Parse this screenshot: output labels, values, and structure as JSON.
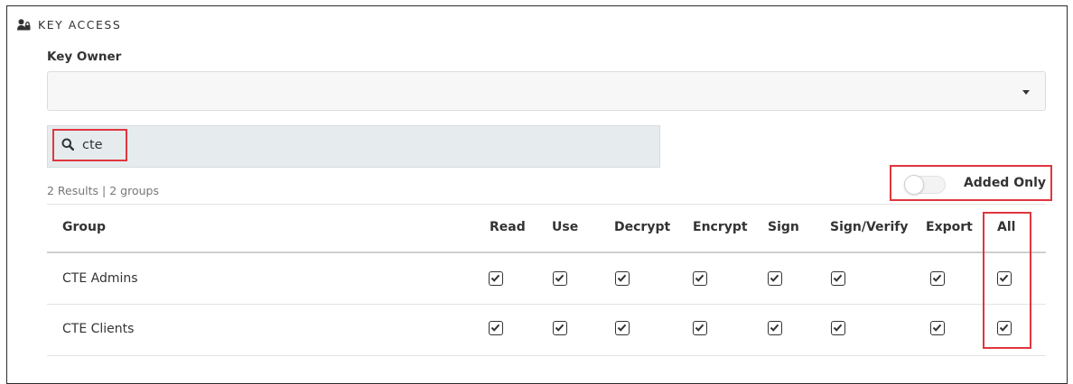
{
  "section": {
    "title": "KEY ACCESS",
    "icon": "user-lock-icon"
  },
  "key_owner": {
    "label": "Key Owner",
    "value": "",
    "dropdown_icon": "caret-down-icon"
  },
  "search": {
    "value": "cte",
    "icon": "search-icon"
  },
  "results_text": "2 Results | 2 groups",
  "added_only": {
    "label": "Added Only",
    "on": false
  },
  "table": {
    "columns": [
      "Group",
      "Read",
      "Use",
      "Decrypt",
      "Encrypt",
      "Sign",
      "Sign/Verify",
      "Export",
      "All"
    ],
    "rows": [
      {
        "group": "CTE Admins",
        "read": true,
        "use": true,
        "decrypt": true,
        "encrypt": true,
        "sign": true,
        "sign_verify": true,
        "export": true,
        "all": true
      },
      {
        "group": "CTE Clients",
        "read": true,
        "use": true,
        "decrypt": true,
        "encrypt": true,
        "sign": true,
        "sign_verify": true,
        "export": true,
        "all": true
      }
    ]
  },
  "colors": {
    "highlight": "#e0363e",
    "search_bg": "#e6ecee"
  }
}
